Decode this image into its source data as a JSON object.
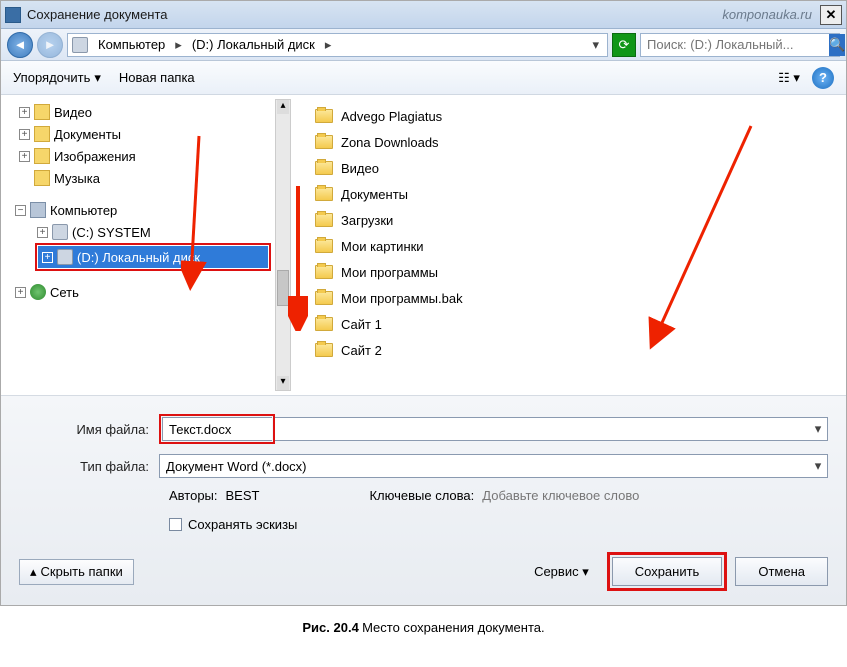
{
  "titlebar": {
    "title": "Сохранение документа",
    "watermark": "komponauka.ru"
  },
  "breadcrumb": {
    "seg1": "Компьютер",
    "seg2": "(D:) Локальный диск"
  },
  "search": {
    "placeholder": "Поиск: (D:) Локальный..."
  },
  "toolbar": {
    "organize": "Упорядочить",
    "newfolder": "Новая папка"
  },
  "tree": {
    "libs": [
      "Видео",
      "Документы",
      "Изображения",
      "Музыка"
    ],
    "computer": "Компьютер",
    "drives": [
      "(C:) SYSTEM",
      "(D:) Локальный диск"
    ],
    "network": "Сеть"
  },
  "files": [
    "Advego Plagiatus",
    "Zona Downloads",
    "Видео",
    "Документы",
    "Загрузки",
    "Мои картинки",
    "Мои программы",
    "Мои программы.bak",
    "Сайт 1",
    "Сайт 2"
  ],
  "form": {
    "filename_label": "Имя файла:",
    "filename_value": "Текст.docx",
    "filetype_label": "Тип файла:",
    "filetype_value": "Документ Word (*.docx)",
    "authors_label": "Авторы:",
    "authors_value": "BEST",
    "keywords_label": "Ключевые слова:",
    "keywords_value": "Добавьте ключевое слово",
    "thumbs_label": "Сохранять эскизы",
    "hide_label": "Скрыть папки",
    "service_label": "Сервис",
    "save_label": "Сохранить",
    "cancel_label": "Отмена"
  },
  "caption": {
    "fig": "Рис. 20.4",
    "text": "Место сохранения документа."
  }
}
